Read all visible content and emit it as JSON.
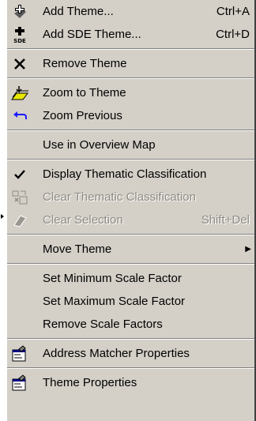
{
  "menu": {
    "groups": [
      [
        {
          "label": "Add Theme...",
          "shortcut": "Ctrl+A",
          "icon": "add-theme-icon"
        },
        {
          "label": "Add SDE Theme...",
          "shortcut": "Ctrl+D",
          "icon": "add-sde-theme-icon",
          "icon_text": "SDE"
        }
      ],
      [
        {
          "label": "Remove Theme",
          "icon": "remove-theme-icon"
        }
      ],
      [
        {
          "label": "Zoom to Theme",
          "icon": "zoom-to-theme-icon"
        },
        {
          "label": "Zoom Previous",
          "icon": "zoom-previous-icon"
        }
      ],
      [
        {
          "label": "Use in Overview Map"
        }
      ],
      [
        {
          "label": "Display Thematic Classification",
          "icon": "checkmark-icon",
          "checked": true
        },
        {
          "label": "Clear Thematic Classification",
          "icon": "clear-classification-icon",
          "disabled": true
        },
        {
          "label": "Clear Selection",
          "shortcut": "Shift+Del",
          "icon": "eraser-icon",
          "disabled": true
        }
      ],
      [
        {
          "label": "Move Theme",
          "submenu": true
        }
      ],
      [
        {
          "label": "Set Minimum Scale Factor"
        },
        {
          "label": "Set Maximum Scale Factor"
        },
        {
          "label": "Remove Scale Factors"
        }
      ],
      [
        {
          "label": "Address Matcher Properties",
          "icon": "properties-icon"
        }
      ],
      [
        {
          "label": "Theme Properties",
          "icon": "properties-icon"
        }
      ]
    ]
  }
}
